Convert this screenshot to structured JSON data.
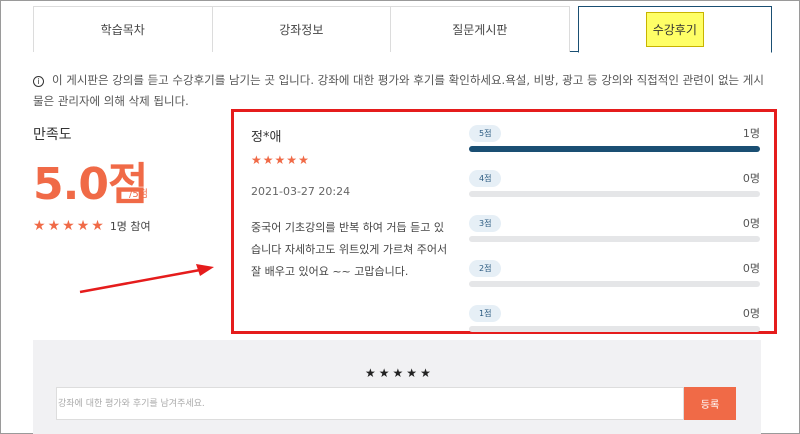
{
  "tabs": [
    {
      "label": "학습목차"
    },
    {
      "label": "강좌정보"
    },
    {
      "label": "질문게시판"
    },
    {
      "label": "수강후기"
    }
  ],
  "notice": {
    "icon": "info-icon",
    "text": "이 게시판은 강의를 듣고 수강후기를 남기는 곳 입니다. 강좌에 대한 평가와 후기를 확인하세요.욕설, 비방, 광고 등 강의와 직접적인 관련이 없는 게시물은 관리자에 의해 삭제 됩니다."
  },
  "satisfaction": {
    "label": "만족도",
    "score": "5.0점",
    "unit": "/5점",
    "rating": 5,
    "participants": "1명 참여"
  },
  "review": {
    "author": "정*애",
    "rating": 5,
    "date": "2021-03-27 20:24",
    "text": "중국어 기초강의를 반복 하여 거듭 듣고 있습니다 자세하고도 위트있게 가르쳐 주어서 잘 배우고 있어요 ~~ 고맙습니다."
  },
  "distribution": [
    {
      "label": "5점",
      "count": "1명",
      "fraction": 1.0
    },
    {
      "label": "4점",
      "count": "0명",
      "fraction": 0
    },
    {
      "label": "3점",
      "count": "0명",
      "fraction": 0
    },
    {
      "label": "2점",
      "count": "0명",
      "fraction": 0
    },
    {
      "label": "1점",
      "count": "0명",
      "fraction": 0
    }
  ],
  "form": {
    "rating": 5,
    "placeholder": "강좌에 대한 평가와 후기를 남겨주세요.",
    "submit_label": "등록"
  },
  "colors": {
    "accent": "#f06a47",
    "primary": "#1a4f73",
    "annotation": "#e51c1c",
    "tab_highlight": "#ffff66"
  }
}
